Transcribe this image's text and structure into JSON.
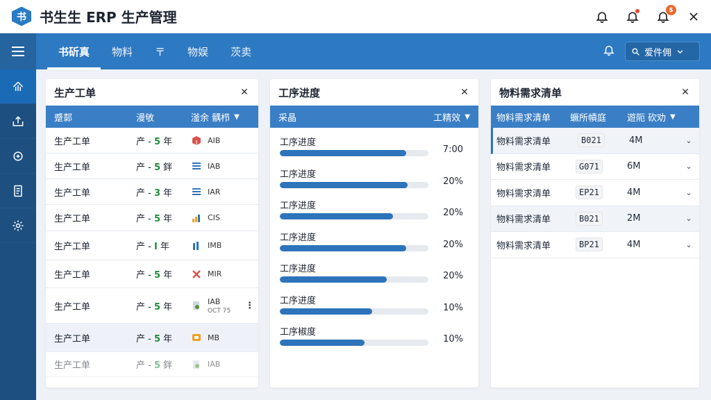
{
  "app": {
    "logo": "书",
    "title": "书生生 ERP 生产管理"
  },
  "titlebar": {
    "notification_count": "$"
  },
  "nav": {
    "tabs": [
      "书斫真",
      "物料",
      "〒",
      "物娱",
      "茨卖"
    ],
    "user_label": "爱件佣"
  },
  "sidebar": {
    "items": [
      "home-icon",
      "export-icon",
      "routing-icon",
      "report-icon",
      "settings-icon"
    ]
  },
  "panels": {
    "work_orders": {
      "title": "生产工单",
      "headers": [
        "蹙䣛",
        "漫敂",
        "滏余 髃栉"
      ],
      "rows": [
        {
          "name": "生产工单",
          "prefix": "产 -",
          "num": "5",
          "unit": "年",
          "icon": "box-icon",
          "code": "AIB",
          "sub": ""
        },
        {
          "name": "生产工单",
          "prefix": "产 -",
          "num": "5",
          "unit": "鉡",
          "icon": "stripes-icon",
          "code": "IAB",
          "sub": ""
        },
        {
          "name": "生产工单",
          "prefix": "产 -",
          "num": "3",
          "unit": "年",
          "icon": "stripes-icon",
          "code": "IAR",
          "sub": ""
        },
        {
          "name": "生产工单",
          "prefix": "产 -",
          "num": "5",
          "unit": "年",
          "icon": "bar-chart-icon",
          "code": "CIS",
          "sub": ""
        },
        {
          "name": "生产工单",
          "prefix": "产 -",
          "num": "I",
          "unit": "年",
          "icon": "bars-icon",
          "code": "IMB",
          "sub": ""
        },
        {
          "name": "生产工单",
          "prefix": "产 -",
          "num": "5",
          "unit": "年",
          "icon": "x-icon",
          "code": "MIR",
          "sub": ""
        },
        {
          "name": "生产工单",
          "prefix": "产 -",
          "num": "5",
          "unit": "年",
          "icon": "gear-doc-icon",
          "code": "IAB",
          "sub": "OCT 75"
        },
        {
          "name": "生产工单",
          "prefix": "产 -",
          "num": "5",
          "unit": "年",
          "icon": "orange-box-icon",
          "code": "MB",
          "sub": ""
        },
        {
          "name": "生产工单",
          "prefix": "产 -",
          "num": "5",
          "unit": "鉡",
          "icon": "gear-doc-icon",
          "code": "IAB",
          "sub": ""
        }
      ]
    },
    "process": {
      "title": "工序进度",
      "headers": [
        "采晶",
        "工精效"
      ],
      "rows": [
        {
          "label": "工序进度",
          "value": "7:00",
          "percent": 85
        },
        {
          "label": "工序进度",
          "value": "20%",
          "percent": 86
        },
        {
          "label": "工序进度",
          "value": "20%",
          "percent": 76
        },
        {
          "label": "工序进度",
          "value": "20%",
          "percent": 85
        },
        {
          "label": "工序进度",
          "value": "20%",
          "percent": 72
        },
        {
          "label": "工序进度",
          "value": "10%",
          "percent": 62
        },
        {
          "label": "工序椒度",
          "value": "10%",
          "percent": 57
        }
      ]
    },
    "materials": {
      "title": "物料需求清单",
      "headers": [
        "物料需求清单",
        "蟩所幘庭",
        "遊阨 砍劝"
      ],
      "rows": [
        {
          "name": "物料需求清单",
          "code": "B021",
          "qty": "4M"
        },
        {
          "name": "物料需求清单",
          "code": "G071",
          "qty": "6M"
        },
        {
          "name": "物料需求清单",
          "code": "EP21",
          "qty": "4M"
        },
        {
          "name": "物料需求清单",
          "code": "B021",
          "qty": "2M"
        },
        {
          "name": "物料需求清单",
          "code": "BP21",
          "qty": "4M"
        }
      ]
    }
  },
  "colors": {
    "primary": "#2d79c2",
    "sidebar": "#1d4f80",
    "accent_green": "#1e8c3a",
    "badge": "#e8672f"
  }
}
